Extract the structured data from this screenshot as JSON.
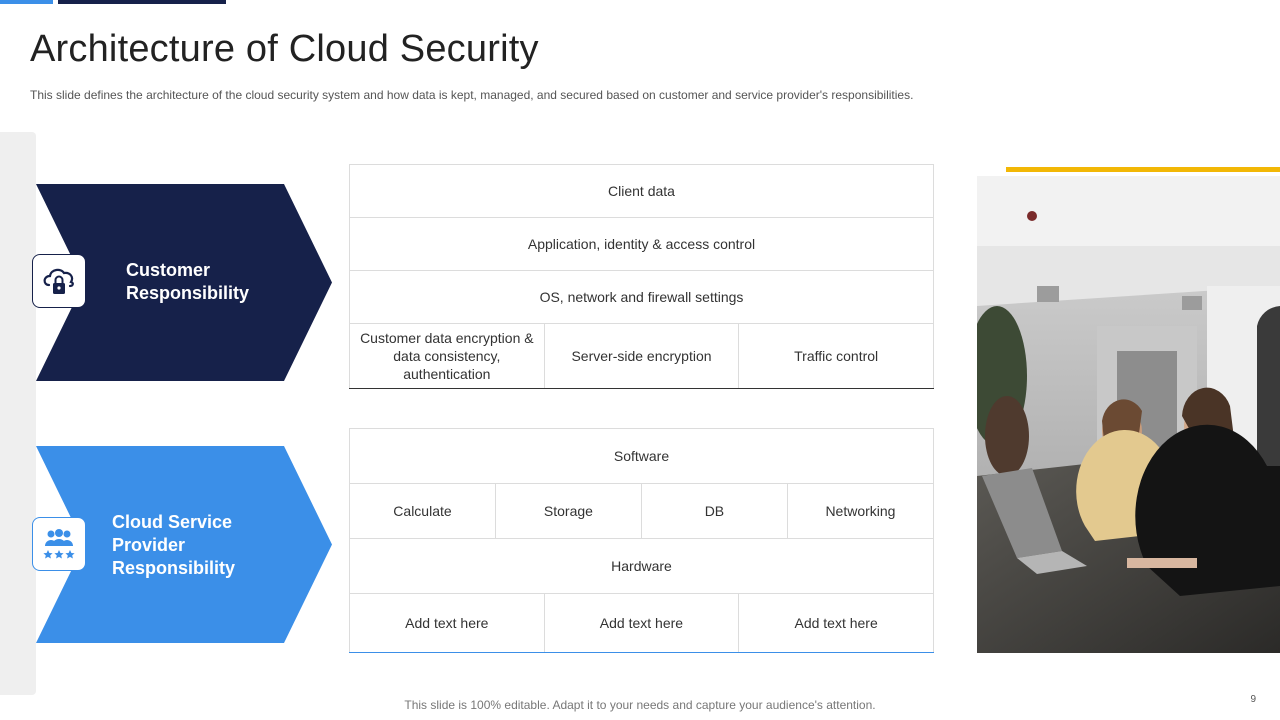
{
  "slide": {
    "title": "Architecture  of Cloud Security",
    "subtitle": "This slide defines the architecture of the cloud security system and how data is kept, managed,  and secured based on customer and service  provider's  responsibilities.",
    "footer": "This slide is 100%  editable. Adapt it to your needs and capture your audience's attention.",
    "page_number": "9"
  },
  "colors": {
    "navy": "#16214a",
    "blue": "#3b8fe8",
    "yellow": "#f2b705"
  },
  "customer": {
    "label": "Customer Responsibility",
    "icon": "cloud-lock-icon",
    "grid": {
      "row1": "Client data",
      "row2": "Application,  identity & access control",
      "row3": "OS, network and firewall settings",
      "row4": [
        "Customer data encryption & data consistency, authentication",
        "Server-side encryption",
        "Traffic control"
      ]
    }
  },
  "provider": {
    "label": "Cloud Service Provider Responsibility",
    "icon": "team-stars-icon",
    "grid": {
      "row1": "Software",
      "row2": [
        "Calculate",
        "Storage",
        "DB",
        "Networking"
      ],
      "row3": "Hardware",
      "row4": [
        "Add text here",
        "Add text here",
        "Add text here"
      ]
    }
  },
  "photo": {
    "icon": "office-photo"
  }
}
